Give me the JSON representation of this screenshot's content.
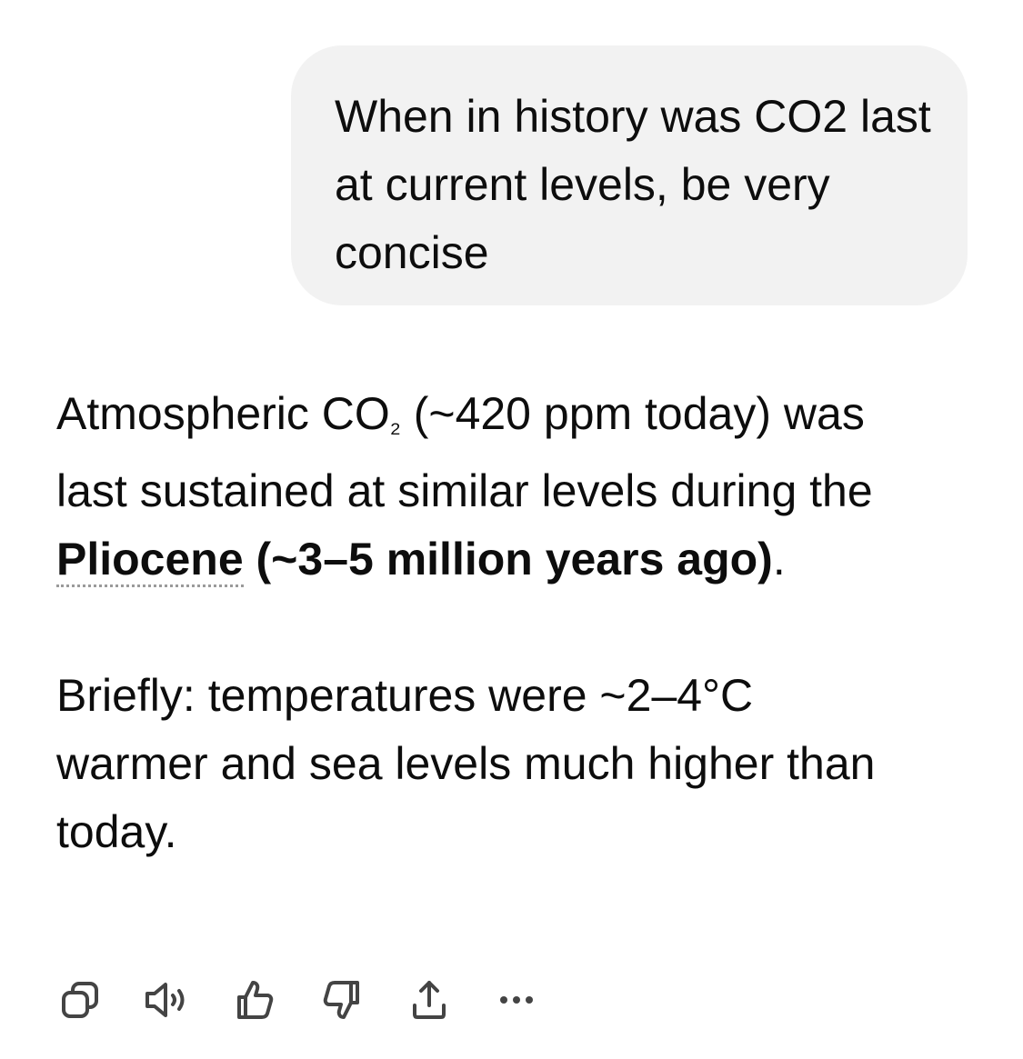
{
  "conversation": {
    "user_message": "When in history was CO2 last at current levels, be very concise",
    "assistant": {
      "p1_a": "Atmospheric CO",
      "p1_sub": "₂",
      "p1_b": " (~420 ppm today) was last sustained at similar levels during the ",
      "p1_term": "Pliocene",
      "p1_bold_rest": " (~3–5 million years ago)",
      "p1_end": ".",
      "p2": "Briefly: temperatures were ~2–4°C warmer and sea levels much higher than today."
    }
  },
  "actions": [
    {
      "icon": "copy-icon"
    },
    {
      "icon": "speaker-icon"
    },
    {
      "icon": "thumbs-up-icon"
    },
    {
      "icon": "thumbs-down-icon"
    },
    {
      "icon": "share-icon"
    },
    {
      "icon": "more-icon"
    }
  ]
}
